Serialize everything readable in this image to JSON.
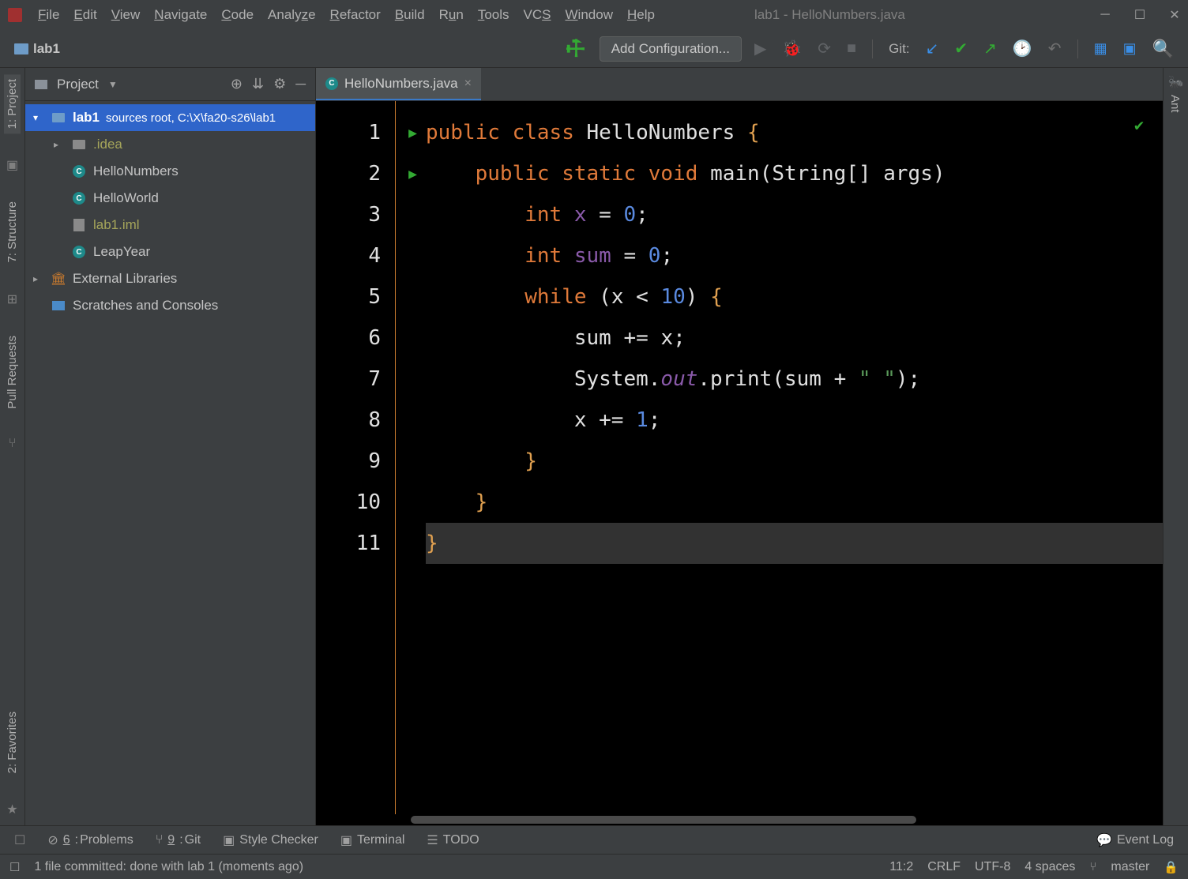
{
  "window": {
    "title": "lab1 - HelloNumbers.java"
  },
  "menu": [
    "File",
    "Edit",
    "View",
    "Navigate",
    "Code",
    "Analyze",
    "Refactor",
    "Build",
    "Run",
    "Tools",
    "VCS",
    "Window",
    "Help"
  ],
  "breadcrumb": "lab1",
  "config_button": "Add Configuration...",
  "git_label": "Git:",
  "project_panel": {
    "title": "Project"
  },
  "tree": {
    "root": {
      "name": "lab1",
      "hint": "sources root,  C:\\X\\fa20-s26\\lab1"
    },
    "idea": ".idea",
    "files": [
      "HelloNumbers",
      "HelloWorld",
      "lab1.iml",
      "LeapYear"
    ],
    "ext": "External Libraries",
    "scratch": "Scratches and Consoles"
  },
  "tab": {
    "name": "HelloNumbers.java"
  },
  "left_tools": {
    "project": "1: Project",
    "structure": "7: Structure",
    "pull": "Pull Requests",
    "fav": "2: Favorites"
  },
  "right_tools": {
    "ant": "Ant"
  },
  "bottom_tools": {
    "problems": "6: Problems",
    "git": "9: Git",
    "style": "Style Checker",
    "terminal": "Terminal",
    "todo": "TODO",
    "eventlog": "Event Log"
  },
  "status": {
    "message": "1 file committed: done with lab 1 (moments ago)",
    "pos": "11:2",
    "le": "CRLF",
    "enc": "UTF-8",
    "indent": "4 spaces",
    "branch": "master"
  },
  "code": {
    "lines": [
      1,
      2,
      3,
      4,
      5,
      6,
      7,
      8,
      9,
      10,
      11
    ],
    "tokens": [
      [
        [
          "kw",
          "public "
        ],
        [
          "kw",
          "class "
        ],
        [
          "id",
          "HelloNumbers "
        ],
        [
          "par",
          "{"
        ]
      ],
      [
        [
          "pun",
          "    "
        ],
        [
          "kw",
          "public "
        ],
        [
          "kw",
          "static "
        ],
        [
          "kw",
          "void "
        ],
        [
          "meth",
          "main"
        ],
        [
          "pun",
          "("
        ],
        [
          "id",
          "String"
        ],
        [
          "pun",
          "[] "
        ],
        [
          "id",
          "args"
        ],
        [
          "pun",
          ")"
        ]
      ],
      [
        [
          "pun",
          "        "
        ],
        [
          "kw",
          "int "
        ],
        [
          "var",
          "x "
        ],
        [
          "pun",
          "= "
        ],
        [
          "num",
          "0"
        ],
        [
          "pun",
          ";"
        ]
      ],
      [
        [
          "pun",
          "        "
        ],
        [
          "kw",
          "int "
        ],
        [
          "var",
          "sum "
        ],
        [
          "pun",
          "= "
        ],
        [
          "num",
          "0"
        ],
        [
          "pun",
          ";"
        ]
      ],
      [
        [
          "pun",
          "        "
        ],
        [
          "kw",
          "while "
        ],
        [
          "pun",
          "("
        ],
        [
          "id",
          "x "
        ],
        [
          "pun",
          "< "
        ],
        [
          "num",
          "10"
        ],
        [
          "pun",
          ") "
        ],
        [
          "par",
          "{"
        ]
      ],
      [
        [
          "pun",
          "            "
        ],
        [
          "id",
          "sum "
        ],
        [
          "pun",
          "+= "
        ],
        [
          "id",
          "x"
        ],
        [
          "pun",
          ";"
        ]
      ],
      [
        [
          "pun",
          "            "
        ],
        [
          "id",
          "System"
        ],
        [
          "pun",
          "."
        ],
        [
          "static-f",
          "out"
        ],
        [
          "pun",
          "."
        ],
        [
          "meth",
          "print"
        ],
        [
          "pun",
          "("
        ],
        [
          "id",
          "sum "
        ],
        [
          "pun",
          "+ "
        ],
        [
          "str",
          "\" \""
        ],
        [
          "pun",
          ");"
        ]
      ],
      [
        [
          "pun",
          "            "
        ],
        [
          "id",
          "x "
        ],
        [
          "pun",
          "+= "
        ],
        [
          "num",
          "1"
        ],
        [
          "pun",
          ";"
        ]
      ],
      [
        [
          "pun",
          "        "
        ],
        [
          "par",
          "}"
        ]
      ],
      [
        [
          "pun",
          "    "
        ],
        [
          "par",
          "}"
        ]
      ],
      [
        [
          "par",
          "}"
        ]
      ]
    ]
  }
}
